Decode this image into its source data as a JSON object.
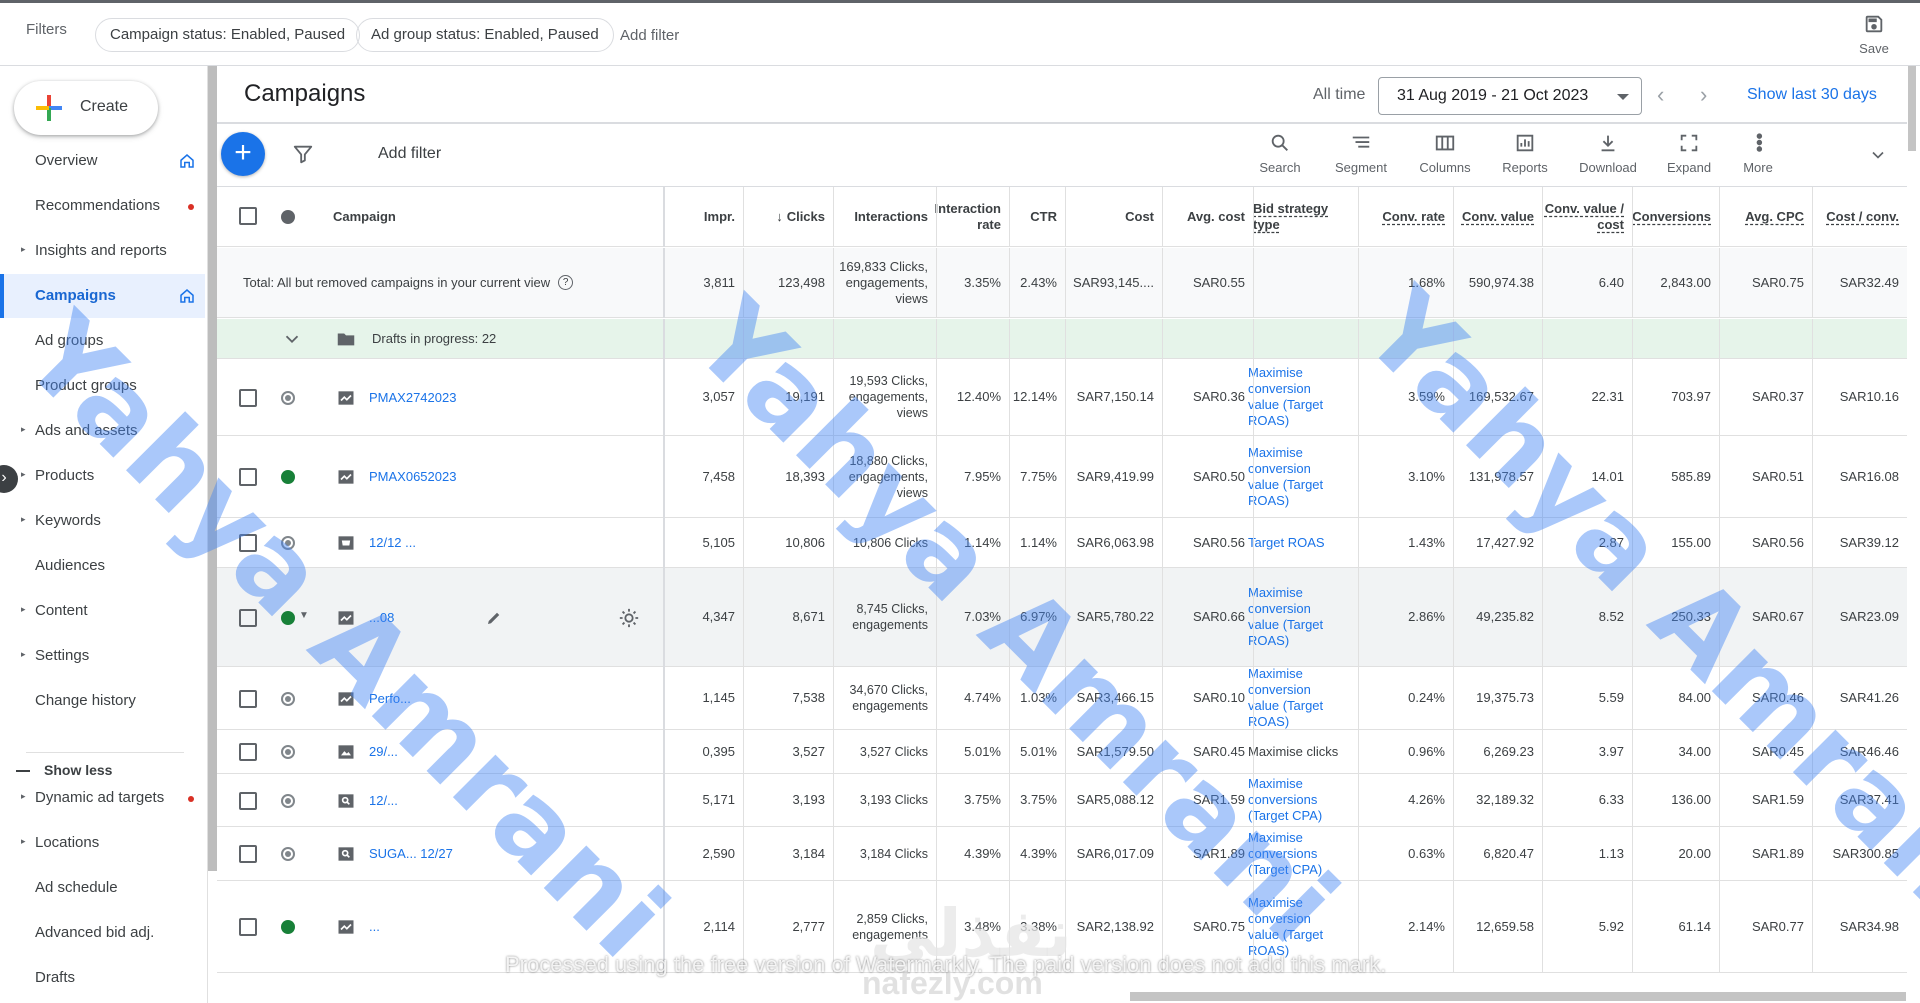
{
  "filters": {
    "label": "Filters",
    "chips": [
      "Campaign status: Enabled, Paused",
      "Ad group status: Enabled, Paused"
    ],
    "add_filter": "Add filter",
    "save_label": "Save"
  },
  "sidebar": {
    "create_label": "Create",
    "items": [
      {
        "label": "Overview",
        "caret": false,
        "icon": "home-icon"
      },
      {
        "label": "Recommendations",
        "caret": false,
        "dot": true
      },
      {
        "label": "Insights and reports",
        "caret": true
      },
      {
        "label": "Campaigns",
        "caret": false,
        "active": true,
        "icon": "home-icon"
      },
      {
        "label": "Ad groups",
        "caret": false
      },
      {
        "label": "Product groups",
        "caret": false
      },
      {
        "label": "Ads and assets",
        "caret": true
      },
      {
        "label": "Products",
        "caret": true
      },
      {
        "label": "Keywords",
        "caret": true
      },
      {
        "label": "Audiences",
        "caret": false
      },
      {
        "label": "Content",
        "caret": true
      },
      {
        "label": "Settings",
        "caret": true
      },
      {
        "label": "Change history",
        "caret": false
      }
    ],
    "show_less": "Show less",
    "more_items": [
      {
        "label": "Dynamic ad targets",
        "caret": true,
        "dot": true
      },
      {
        "label": "Locations",
        "caret": true
      },
      {
        "label": "Ad schedule",
        "caret": false
      },
      {
        "label": "Advanced bid adj.",
        "caret": false
      },
      {
        "label": "Drafts",
        "caret": false
      }
    ]
  },
  "header": {
    "title": "Campaigns",
    "all_time": "All time",
    "date_range": "31 Aug 2019 - 21 Oct 2023",
    "show_last": "Show last 30 days"
  },
  "toolbar": {
    "add_filter": "Add filter",
    "tools": [
      {
        "label": "Search",
        "icon": "search-icon"
      },
      {
        "label": "Segment",
        "icon": "segment-icon"
      },
      {
        "label": "Columns",
        "icon": "columns-icon"
      },
      {
        "label": "Reports",
        "icon": "reports-icon"
      },
      {
        "label": "Download",
        "icon": "download-icon"
      },
      {
        "label": "Expand",
        "icon": "expand-icon"
      },
      {
        "label": "More",
        "icon": "more-vert-icon"
      }
    ]
  },
  "table": {
    "columns": {
      "campaign": "Campaign",
      "impr": "Impr.",
      "clicks": "Clicks",
      "interactions": "Interactions",
      "interaction_rate": "Interaction rate",
      "ctr": "CTR",
      "cost": "Cost",
      "avg_cost": "Avg. cost",
      "bid_strategy": "Bid strategy type",
      "conv_rate": "Conv. rate",
      "conv_value": "Conv. value",
      "conv_value_cost": "Conv. value / cost",
      "conversions": "Conversions",
      "avg_cpc": "Avg. CPC",
      "cost_conv": "Cost / conv."
    },
    "total": {
      "label": "Total: All but removed campaigns in your current view",
      "impr": "3,811",
      "clicks": "123,498",
      "interactions": "169,833 Clicks, engagements, views",
      "interaction_rate": "3.35%",
      "ctr": "2.43%",
      "cost": "SAR93,145....",
      "avg_cost": "SAR0.55",
      "bid_strategy": "",
      "conv_rate": "1.68%",
      "conv_value": "590,974.38",
      "conv_value_cost": "6.40",
      "conversions": "2,843.00",
      "avg_cpc": "SAR0.75",
      "cost_conv": "SAR32.49"
    },
    "drafts_label": "Drafts in progress: 22",
    "rows": [
      {
        "status": "paused",
        "type": "pmax",
        "name": "PMAX2742023",
        "impr": "3,057",
        "clicks": "19,191",
        "interactions": "19,593 Clicks, engagements, views",
        "interaction_rate": "12.40%",
        "ctr": "12.14%",
        "cost": "SAR7,150.14",
        "avg_cost": "SAR0.36",
        "bid_strategy": "Maximise conversion value (Target ROAS)",
        "conv_rate": "3.59%",
        "conv_value": "169,532.67",
        "conv_value_cost": "22.31",
        "conversions": "703.97",
        "avg_cpc": "SAR0.37",
        "cost_conv": "SAR10.16"
      },
      {
        "status": "enabled",
        "type": "pmax",
        "name": "PMAX0652023",
        "impr": "7,458",
        "clicks": "18,393",
        "interactions": "18,880 Clicks, engagements, views",
        "interaction_rate": "7.95%",
        "ctr": "7.75%",
        "cost": "SAR9,419.99",
        "avg_cost": "SAR0.50",
        "bid_strategy": "Maximise conversion value (Target ROAS)",
        "conv_rate": "3.10%",
        "conv_value": "131,978.57",
        "conv_value_cost": "14.01",
        "conversions": "585.89",
        "avg_cpc": "SAR0.51",
        "cost_conv": "SAR16.08"
      },
      {
        "status": "paused",
        "type": "shopping",
        "name": "12/12 ...",
        "impr": "5,105",
        "clicks": "10,806",
        "interactions": "10,806 Clicks",
        "interaction_rate": "1.14%",
        "ctr": "1.14%",
        "cost": "SAR6,063.98",
        "avg_cost": "SAR0.56",
        "bid_strategy": "Target ROAS",
        "conv_rate": "1.43%",
        "conv_value": "17,427.92",
        "conv_value_cost": "2.87",
        "conversions": "155.00",
        "avg_cpc": "SAR0.56",
        "cost_conv": "SAR39.12"
      },
      {
        "status": "enabled",
        "type": "pmax",
        "name": "...08",
        "impr": "4,347",
        "clicks": "8,671",
        "interactions": "8,745 Clicks, engagements",
        "interaction_rate": "7.03%",
        "ctr": "6.97%",
        "cost": "SAR5,780.22",
        "avg_cost": "SAR0.66",
        "bid_strategy": "Maximise conversion value (Target ROAS)",
        "conv_rate": "2.86%",
        "conv_value": "49,235.82",
        "conv_value_cost": "8.52",
        "conversions": "250.33",
        "avg_cpc": "SAR0.67",
        "cost_conv": "SAR23.09",
        "hover": true
      },
      {
        "status": "paused",
        "type": "pmax",
        "name": "Perfo...",
        "impr": "1,145",
        "clicks": "7,538",
        "interactions": "34,670 Clicks, engagements",
        "interaction_rate": "4.74%",
        "ctr": "1.03%",
        "cost": "SAR3,466.15",
        "avg_cost": "SAR0.10",
        "bid_strategy": "Maximise conversion value (Target ROAS)",
        "conv_rate": "0.24%",
        "conv_value": "19,375.73",
        "conv_value_cost": "5.59",
        "conversions": "84.00",
        "avg_cpc": "SAR0.46",
        "cost_conv": "SAR41.26"
      },
      {
        "status": "paused",
        "type": "display",
        "name": "29/...",
        "impr": "0,395",
        "clicks": "3,527",
        "interactions": "3,527 Clicks",
        "interaction_rate": "5.01%",
        "ctr": "5.01%",
        "cost": "SAR1,579.50",
        "avg_cost": "SAR0.45",
        "bid_strategy": "Maximise clicks",
        "bid_plain": true,
        "conv_rate": "0.96%",
        "conv_value": "6,269.23",
        "conv_value_cost": "3.97",
        "conversions": "34.00",
        "avg_cpc": "SAR0.45",
        "cost_conv": "SAR46.46"
      },
      {
        "status": "paused",
        "type": "search",
        "name": "12/...",
        "impr": "5,171",
        "clicks": "3,193",
        "interactions": "3,193 Clicks",
        "interaction_rate": "3.75%",
        "ctr": "3.75%",
        "cost": "SAR5,088.12",
        "avg_cost": "SAR1.59",
        "bid_strategy": "Maximise conversions (Target CPA)",
        "conv_rate": "4.26%",
        "conv_value": "32,189.32",
        "conv_value_cost": "6.33",
        "conversions": "136.00",
        "avg_cpc": "SAR1.59",
        "cost_conv": "SAR37.41"
      },
      {
        "status": "paused",
        "type": "search",
        "name": "SUGA... 12/27",
        "impr": "2,590",
        "clicks": "3,184",
        "interactions": "3,184 Clicks",
        "interaction_rate": "4.39%",
        "ctr": "4.39%",
        "cost": "SAR6,017.09",
        "avg_cost": "SAR1.89",
        "bid_strategy": "Maximise conversions (Target CPA)",
        "conv_rate": "0.63%",
        "conv_value": "6,820.47",
        "conv_value_cost": "1.13",
        "conversions": "20.00",
        "avg_cpc": "SAR1.89",
        "cost_conv": "SAR300.85"
      },
      {
        "status": "enabled",
        "type": "pmax",
        "name": "...",
        "impr": "2,114",
        "clicks": "2,777",
        "interactions": "2,859 Clicks, engagements",
        "interaction_rate": "3.48%",
        "ctr": "3.38%",
        "cost": "SAR2,138.92",
        "avg_cost": "SAR0.75",
        "bid_strategy": "Maximise conversion value (Target ROAS)",
        "conv_rate": "2.14%",
        "conv_value": "12,659.58",
        "conv_value_cost": "5.92",
        "conversions": "61.14",
        "avg_cpc": "SAR0.77",
        "cost_conv": "SAR34.98"
      }
    ]
  },
  "watermarks": {
    "diagonal": "Yahya Amrani",
    "bottom_notice": "Processed using the free version of Watermarkly. The paid version does not add this mark.",
    "site": "nafezly.com",
    "arabic": "نفذلي"
  },
  "colors": {
    "accent": "#1a73e8",
    "enabled": "#188038",
    "paused": "#80868b",
    "drafts_bg": "#e6f4ea",
    "alert_dot": "#d93025"
  }
}
